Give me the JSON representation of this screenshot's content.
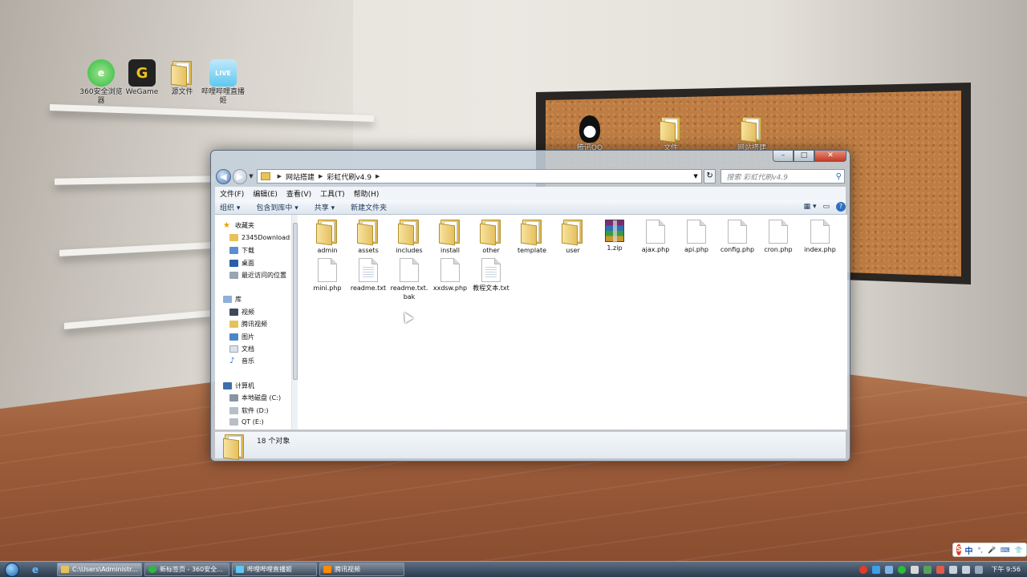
{
  "desktop": {
    "icons": [
      {
        "label": "360安全浏览器",
        "icon": "360-browser-icon",
        "color": "#2dbb3a"
      },
      {
        "label": "WeGame",
        "icon": "wegame-icon",
        "color": "#f2c01b"
      },
      {
        "label": "源文件",
        "icon": "folder-icon",
        "color": "#e6c25c"
      },
      {
        "label": "哔哩哔哩直播姬",
        "icon": "bilibili-live-icon",
        "color": "#5ec8f0"
      }
    ],
    "board_icons": [
      {
        "label": "腾讯QQ",
        "icon": "qq-penguin-icon"
      },
      {
        "label": "文件",
        "icon": "folder-icon"
      },
      {
        "label": "网站搭建",
        "icon": "folder-icon"
      }
    ]
  },
  "window": {
    "caption": {
      "minimize": "–",
      "maximize": "□",
      "close": "✕"
    },
    "address": {
      "crumbs": [
        "网站搭建",
        "彩虹代刷v4.9"
      ]
    },
    "search_placeholder": "搜索 彩虹代刷v4.9",
    "menu": [
      "文件(F)",
      "编辑(E)",
      "查看(V)",
      "工具(T)",
      "帮助(H)"
    ],
    "commands": [
      "组织 ▾",
      "包含到库中 ▾",
      "共享 ▾",
      "新建文件夹"
    ],
    "nav_pane": {
      "favorites_header": "收藏夹",
      "favorites": [
        "2345Downloads",
        "下载",
        "桌面",
        "最近访问的位置"
      ],
      "libraries_header": "库",
      "libraries": [
        "视频",
        "腾讯视频",
        "图片",
        "文档",
        "音乐"
      ],
      "computer_header": "计算机",
      "drives": [
        "本地磁盘 (C:)",
        "软件 (D:)",
        "QT (E:)"
      ]
    },
    "files": [
      {
        "name": "admin",
        "type": "folder"
      },
      {
        "name": "assets",
        "type": "folder"
      },
      {
        "name": "includes",
        "type": "folder"
      },
      {
        "name": "install",
        "type": "folder"
      },
      {
        "name": "other",
        "type": "folder"
      },
      {
        "name": "template",
        "type": "folder"
      },
      {
        "name": "user",
        "type": "folder"
      },
      {
        "name": "1.zip",
        "type": "zip"
      },
      {
        "name": "ajax.php",
        "type": "file"
      },
      {
        "name": "api.php",
        "type": "file"
      },
      {
        "name": "config.php",
        "type": "file"
      },
      {
        "name": "cron.php",
        "type": "file"
      },
      {
        "name": "index.php",
        "type": "file"
      },
      {
        "name": "mini.php",
        "type": "file"
      },
      {
        "name": "readme.txt",
        "type": "text"
      },
      {
        "name": "readme.txt.bak",
        "type": "file"
      },
      {
        "name": "xxdsw.php",
        "type": "file"
      },
      {
        "name": "教程文本.txt",
        "type": "text"
      }
    ],
    "status": "18 个对象"
  },
  "taskbar": {
    "tasks": [
      {
        "label": "C:\\Users\\Administr...",
        "active": true,
        "color": "#e6c25c"
      },
      {
        "label": "新标签页 - 360安全...",
        "active": false,
        "color": "#2dbb3a"
      },
      {
        "label": "哔哩哔哩直播姬",
        "active": false,
        "color": "#5ec8f0"
      },
      {
        "label": "腾讯视频",
        "active": false,
        "color": "#ff8a00"
      }
    ],
    "clock": "下午 9:56"
  },
  "ime": {
    "logo": "S",
    "lang": "中",
    "extras": [
      "°,",
      "🎤",
      "⌨",
      "👕"
    ]
  }
}
